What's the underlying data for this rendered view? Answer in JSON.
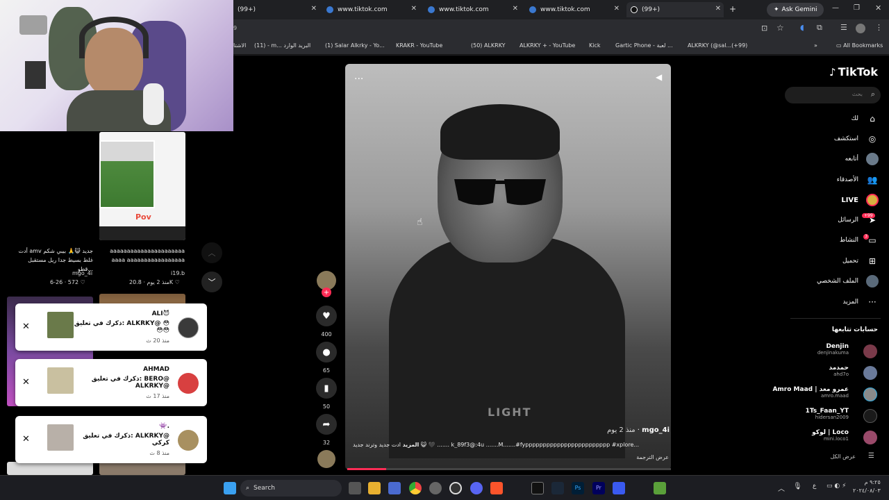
{
  "tabs": [
    {
      "label": "(99+)"
    },
    {
      "label": "www.tiktok.com"
    },
    {
      "label": "www.tiktok.com"
    },
    {
      "label": "www.tiktok.com"
    },
    {
      "label": "(99+)"
    }
  ],
  "ask_gemini": "Ask Gemini",
  "address_text": "9",
  "bookmarks": [
    "الاشتا",
    "(11) - m... البريد الوارد",
    "(1) Salar Alkrky - Yo...",
    "KRAKR - YouTube",
    "(50) ALKRKY",
    "ALKRKY + - YouTube",
    "Kick",
    "Gartic Phone - لعبة ...",
    "ALKRKY (@sal...(+99)"
  ],
  "all_bookmarks": "All Bookmarks",
  "left_feed": {
    "pov_label": "Pov",
    "card1": {
      "caption": "أدت amv جديد 😺🙏 بيبي شكم غلط بسيط جدا ريل مستقبل قطو...",
      "user": "mgo_4i",
      "likes": "572",
      "date": "6-26"
    },
    "card2": {
      "caption": "aaaaaaaaaaaaaaaaaaaaaaaaaa aaaaaaaaaaaaaaaaaaaaaaaaaaaaa...",
      "user": "i19.b",
      "likes": "20.8K",
      "date": "منذ 2 يوم"
    }
  },
  "notifications": [
    {
      "name": "ALI😈",
      "msg": "ذكرك في تعليق: ALKRKY@ 😳 😳😳",
      "time": "منذ 20 ث"
    },
    {
      "name": "AHMAD",
      "msg": "ذكرك في تعليق: BERO@ ALKRKY@",
      "time": "منذ 17 ث"
    },
    {
      "name": "👾.",
      "msg": "ذكرك في تعليق: ALKRKY@ كركي",
      "time": "منذ 8 ث"
    }
  ],
  "video": {
    "more": "...",
    "watermark": "LIGHT",
    "author": "mgo_4i",
    "posted": "منذ 2 يوم",
    "caption": "ادت جديد وترند جديد 😺 🖤 ....... k_89f3@:4u .......M.......#fypppppppppppppppppppppppp #xplore...",
    "more_label": "المزيد",
    "translate": "عرض الترجمة"
  },
  "actions": {
    "likes": "400",
    "comments": "65",
    "saves": "50",
    "shares": "32"
  },
  "nav": {
    "logo": "TikTok",
    "search_placeholder": "بحث",
    "items": [
      "لك",
      "استكشف",
      "أتابعه",
      "الأصدقاء",
      "LIVE",
      "الرسائل",
      "النشاط",
      "تحميل",
      "الملف الشخصي",
      "المزيد"
    ],
    "messages_badge": "+99",
    "activity_badge": "3",
    "following_title": "حسابات تتابعها",
    "following": [
      {
        "name": "Denjin",
        "user": "denjinakuma"
      },
      {
        "name": "حمدمد",
        "user": "ahd7o"
      },
      {
        "name": "Amro Maad | عمرو معد",
        "user": "amro.maad"
      },
      {
        "name": "1Ts_Faan_YT",
        "user": "hidersan2009"
      },
      {
        "name": "لوكو | Loco",
        "user": "mini.loco1"
      }
    ],
    "see_all": "عرض الكل"
  },
  "taskbar": {
    "search": "Search",
    "time": "٩:٢٥ م",
    "date": "٢٠٢٤/٠٨/٠٣"
  }
}
